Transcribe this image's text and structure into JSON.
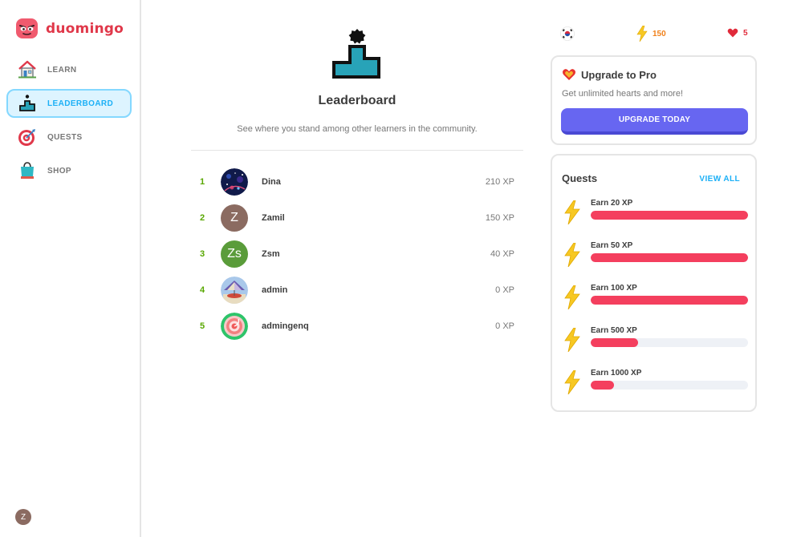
{
  "app": {
    "name": "duomingo"
  },
  "sidebar": {
    "items": [
      {
        "label": "LEARN",
        "icon": "house-icon"
      },
      {
        "label": "LEADERBOARD",
        "icon": "podium-icon",
        "active": true
      },
      {
        "label": "QUESTS",
        "icon": "target-icon"
      },
      {
        "label": "SHOP",
        "icon": "shopping-bag-icon"
      }
    ],
    "user_initial": "Z"
  },
  "main": {
    "title": "Leaderboard",
    "subtitle": "See where you stand among other learners in the community.",
    "entries": [
      {
        "rank": "1",
        "name": "Dina",
        "xp": "210 XP",
        "avatar": "space-image"
      },
      {
        "rank": "2",
        "name": "Zamil",
        "xp": "150 XP",
        "avatar_text": "Z",
        "color": "#8b6b61"
      },
      {
        "rank": "3",
        "name": "Zsm",
        "xp": "40 XP",
        "avatar_text": "Zs",
        "color": "#5a9c3a"
      },
      {
        "rank": "4",
        "name": "admin",
        "xp": "0 XP",
        "avatar": "carousel-image"
      },
      {
        "rank": "5",
        "name": "admingenq",
        "xp": "0 XP",
        "avatar": "swirl-image"
      }
    ]
  },
  "stats": {
    "flag": "korea-flag-icon",
    "xp": "150",
    "hearts": "5"
  },
  "pro": {
    "title": "Upgrade to Pro",
    "description": "Get unlimited hearts and more!",
    "button": "UPGRADE TODAY"
  },
  "quests": {
    "title": "Quests",
    "view_all": "VIEW ALL",
    "items": [
      {
        "label": "Earn 20 XP",
        "progress": 1.0
      },
      {
        "label": "Earn 50 XP",
        "progress": 1.0
      },
      {
        "label": "Earn 100 XP",
        "progress": 1.0
      },
      {
        "label": "Earn 500 XP",
        "progress": 0.3
      },
      {
        "label": "Earn 1000 XP",
        "progress": 0.15
      }
    ]
  },
  "colors": {
    "brand": "#e0384a",
    "accent": "#1cb0f6",
    "rank": "#58a700",
    "button": "#6766f1",
    "progress": "#f43f5e"
  }
}
